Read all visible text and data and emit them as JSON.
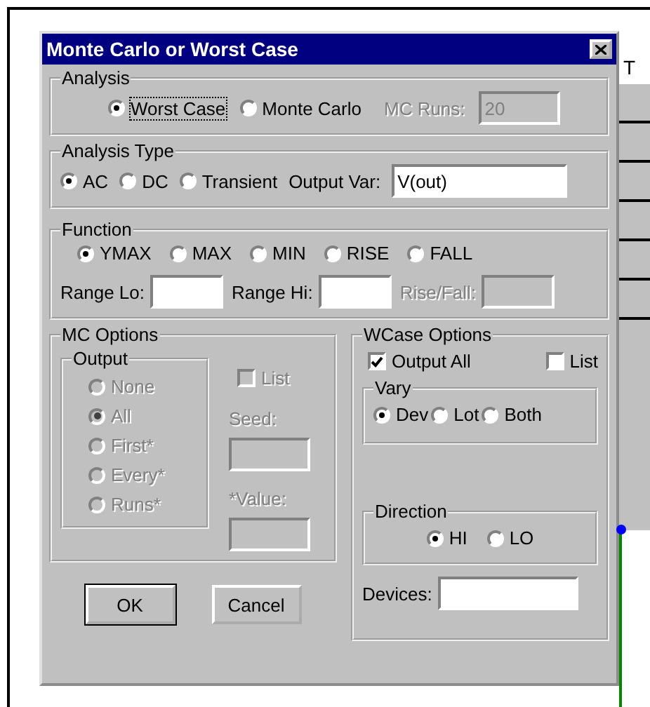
{
  "window": {
    "title": "Monte Carlo or Worst Case"
  },
  "background": {
    "text": "T"
  },
  "analysis": {
    "legend": "Analysis",
    "options": [
      {
        "label": "Worst Case",
        "selected": true,
        "focused": true
      },
      {
        "label": "Monte Carlo",
        "selected": false,
        "focused": false
      }
    ],
    "mc_runs": {
      "label": "MC Runs:",
      "value": "20",
      "disabled": true
    }
  },
  "analysis_type": {
    "legend": "Analysis Type",
    "options": [
      {
        "label": "AC",
        "selected": true
      },
      {
        "label": "DC",
        "selected": false
      },
      {
        "label": "Transient",
        "selected": false
      }
    ],
    "output_var": {
      "label": "Output Var:",
      "value": "V(out)"
    }
  },
  "function": {
    "legend": "Function",
    "options": [
      {
        "label": "YMAX",
        "selected": true
      },
      {
        "label": "MAX",
        "selected": false
      },
      {
        "label": "MIN",
        "selected": false
      },
      {
        "label": "RISE",
        "selected": false
      },
      {
        "label": "FALL",
        "selected": false
      }
    ],
    "fields": [
      {
        "label": "Range Lo:",
        "disabled": false
      },
      {
        "label": "Range Hi:",
        "disabled": false
      },
      {
        "label": "Rise/Fall:",
        "disabled": true
      }
    ]
  },
  "mc_options": {
    "legend": "MC Options",
    "disabled": true,
    "output": {
      "legend": "Output",
      "options": [
        {
          "label": "None",
          "selected": false
        },
        {
          "label": "All",
          "selected": true
        },
        {
          "label": "First*",
          "selected": false
        },
        {
          "label": "Every*",
          "selected": false
        },
        {
          "label": "Runs*",
          "selected": false
        }
      ]
    },
    "list": {
      "label": "List",
      "checked": false
    },
    "fields": [
      {
        "label": "Seed:"
      },
      {
        "label": "*Value:"
      }
    ]
  },
  "wcase_options": {
    "legend": "WCase Options",
    "checkboxes": [
      {
        "label": "Output All",
        "checked": true
      },
      {
        "label": "List",
        "checked": false
      }
    ],
    "vary": {
      "legend": "Vary",
      "options": [
        {
          "label": "Dev",
          "selected": true
        },
        {
          "label": "Lot",
          "selected": false
        },
        {
          "label": "Both",
          "selected": false
        }
      ]
    },
    "direction": {
      "legend": "Direction",
      "options": [
        {
          "label": "HI",
          "selected": true
        },
        {
          "label": "LO",
          "selected": false
        }
      ]
    },
    "devices": {
      "label": "Devices:"
    }
  },
  "buttons": [
    {
      "label": "OK",
      "default": true
    },
    {
      "label": "Cancel",
      "default": false
    }
  ]
}
